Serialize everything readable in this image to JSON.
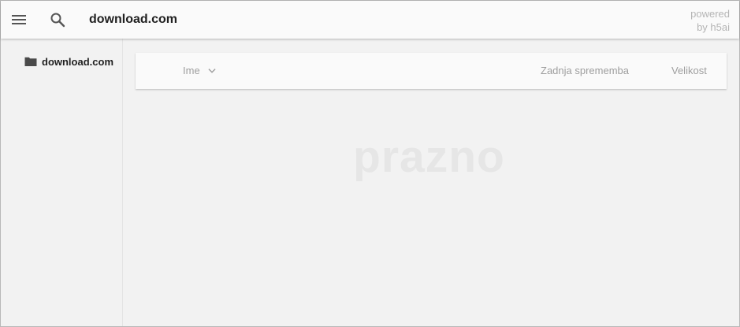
{
  "topbar": {
    "breadcrumb": "download.com",
    "powered_line1": "powered",
    "powered_line2": "by h5ai",
    "icons": {
      "menu": "hamburger-menu-icon",
      "search": "search-icon"
    }
  },
  "sidebar": {
    "tree": [
      {
        "label": "download.com",
        "icon": "folder-icon"
      }
    ]
  },
  "listing": {
    "columns": {
      "name": "Ime",
      "modified": "Zadnja sprememba",
      "size": "Velikost"
    },
    "sort_icon": "chevron-down-icon",
    "empty_text": "prazno"
  },
  "colors": {
    "topbar_bg": "#fafafa",
    "page_bg": "#f2f2f2",
    "text_dark": "#212121",
    "text_muted": "#9e9e9e"
  }
}
